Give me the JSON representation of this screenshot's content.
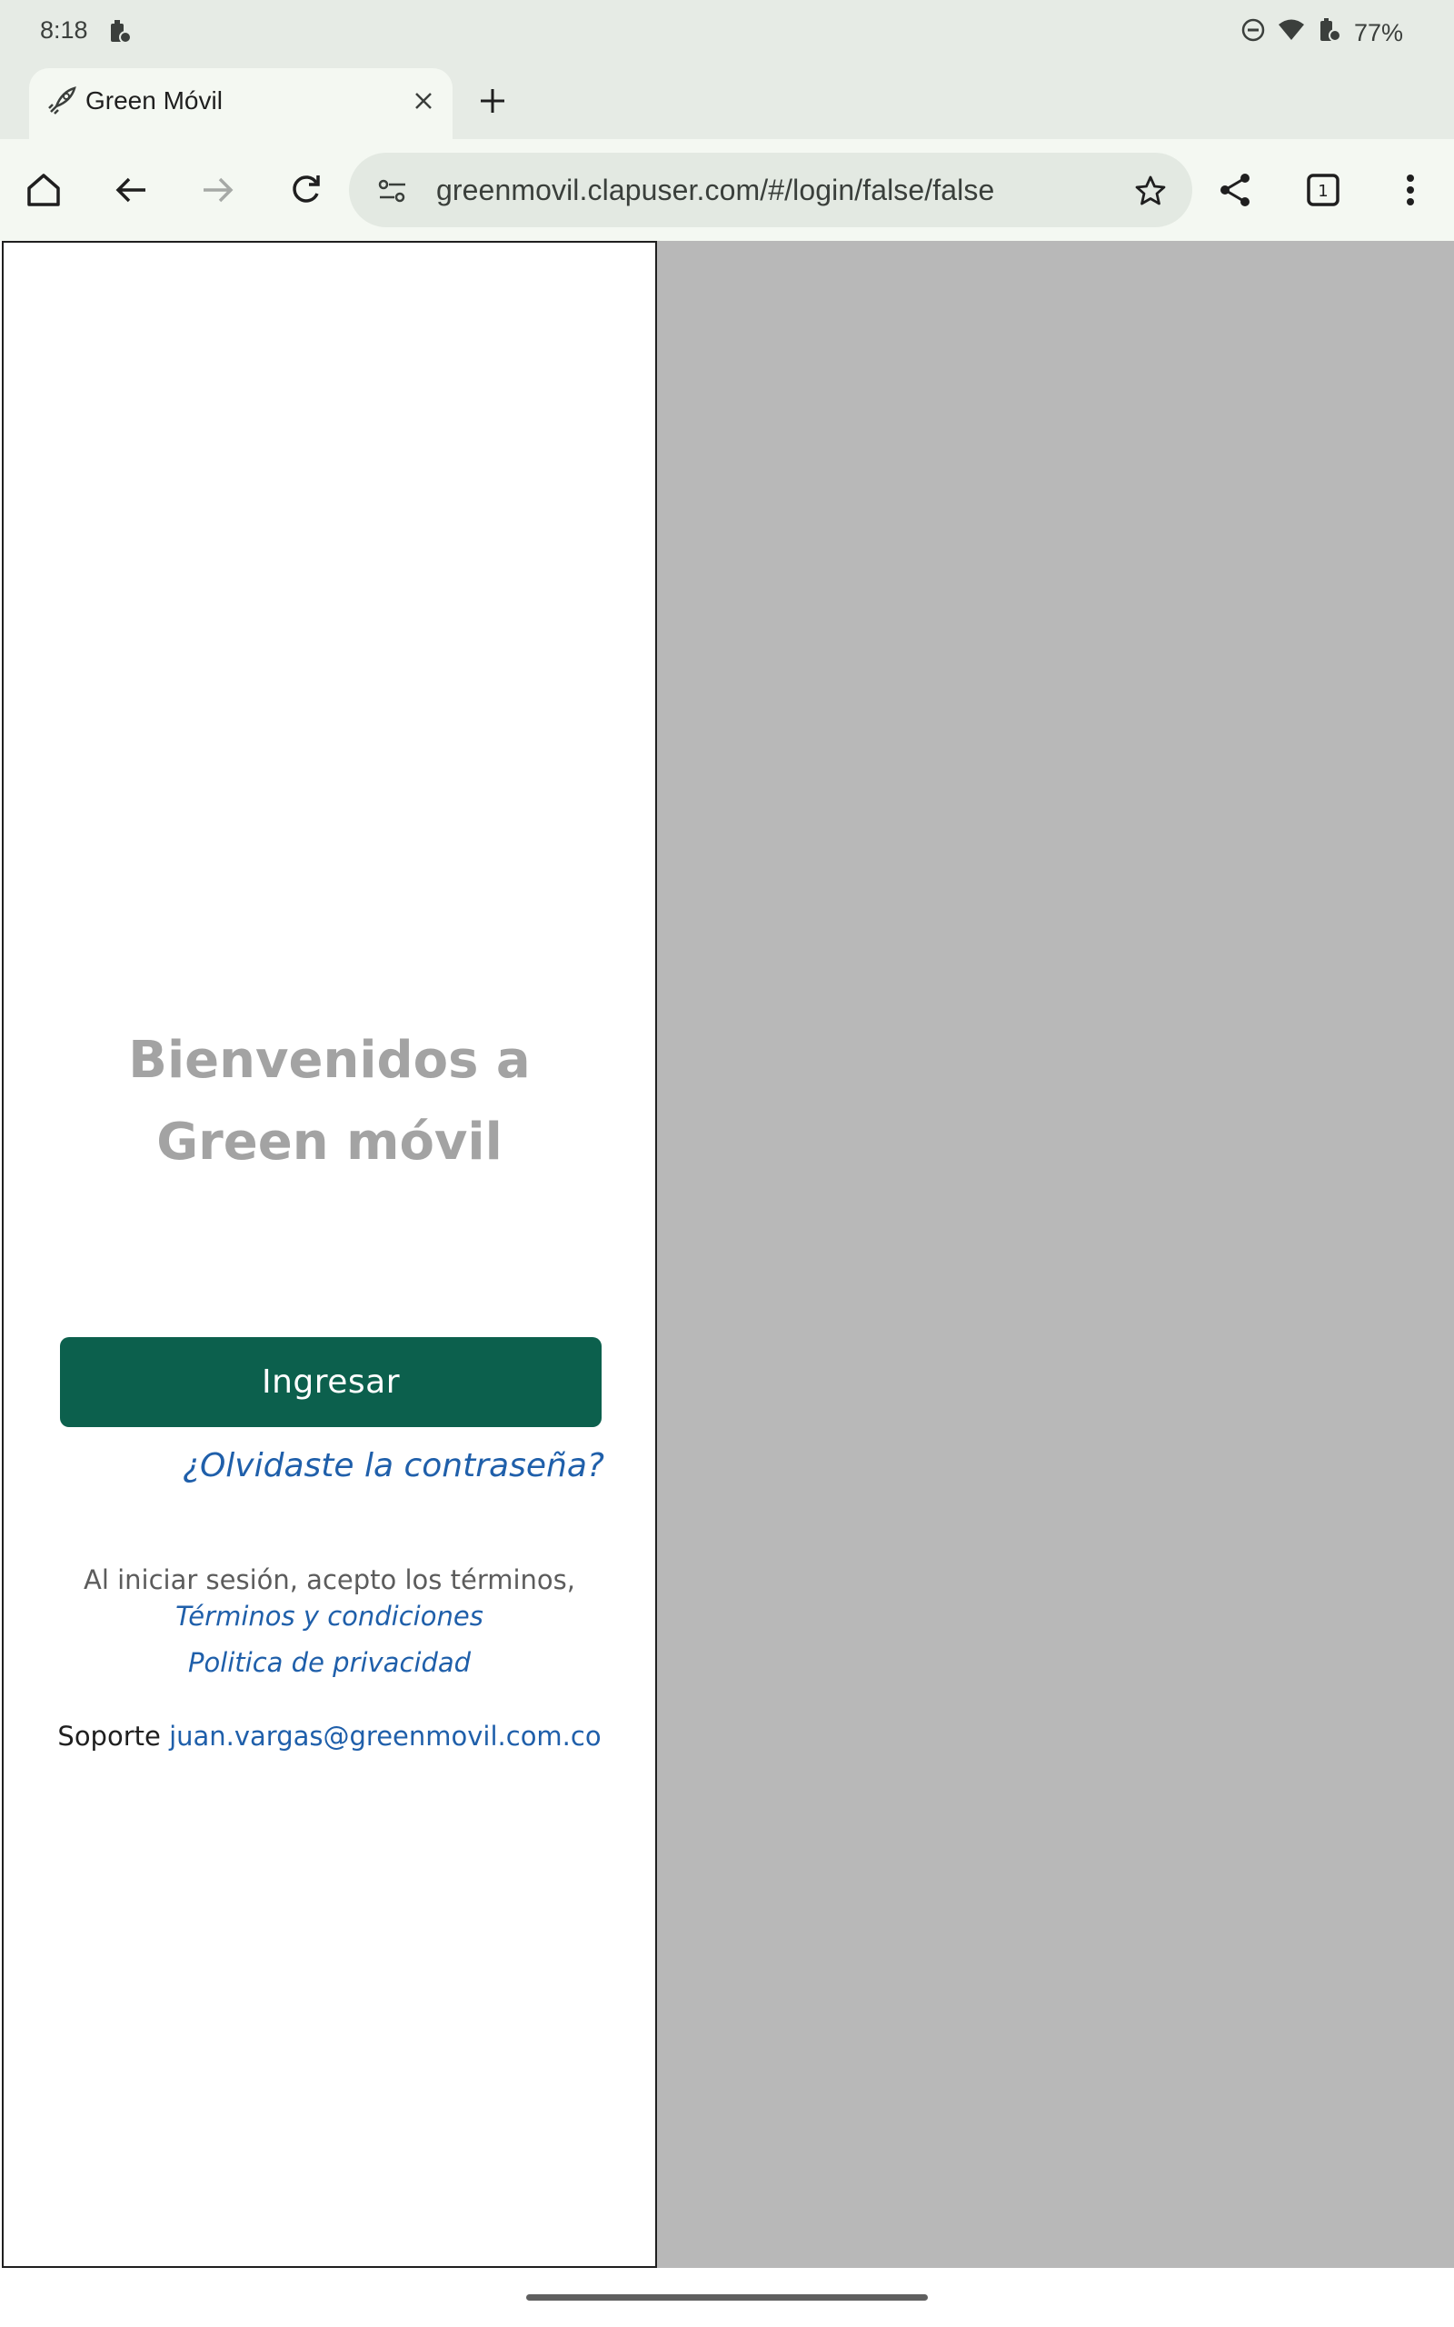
{
  "status_bar": {
    "time": "8:18",
    "battery_percent": "77%",
    "icons": [
      "notification-lock-icon",
      "do-not-disturb-icon",
      "wifi-icon",
      "battery-icon"
    ]
  },
  "browser": {
    "tab_title": "Green Móvil",
    "tab_icon": "rocket-icon",
    "url": "greenmovil.clapuser.com/#/login/false/false",
    "tab_count": "1"
  },
  "login": {
    "welcome_line1": "Bienvenidos a",
    "welcome_line2": "Green móvil",
    "login_button": "Ingresar",
    "forgot_password": "¿Olvidaste la contraseña?",
    "terms_text": "Al iniciar sesión, acepto los términos,",
    "terms_link": "Términos y condiciones",
    "privacy_link": "Politica de privacidad",
    "support_label": "Soporte",
    "support_email": "juan.vargas@greenmovil.com.co"
  },
  "colors": {
    "brand_green": "#0c604d",
    "link_blue": "#1f5faa",
    "welcome_gray": "#a3a3a3"
  }
}
